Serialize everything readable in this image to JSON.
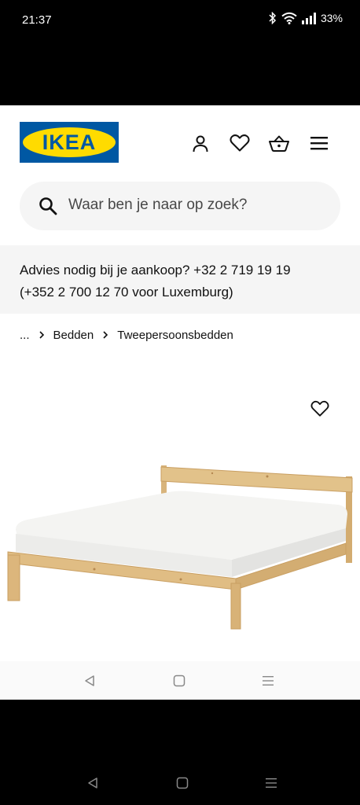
{
  "status_bar": {
    "time": "21:37",
    "battery": "33%",
    "icons": [
      "bluetooth-icon",
      "wifi-icon",
      "signal-icon"
    ]
  },
  "header": {
    "logo_text": "IKEA",
    "brand_colors": {
      "blue": "#0058a3",
      "yellow": "#ffdb00"
    },
    "icons": [
      "account-icon",
      "wishlist-heart-icon",
      "shopping-basket-icon",
      "menu-icon"
    ]
  },
  "search": {
    "placeholder": "Waar ben je naar op zoek?",
    "icon": "search-icon"
  },
  "advice_banner": {
    "line1": "Advies nodig bij je aankoop? +32 2 719 19 19",
    "line2": "(+352 2 700 12 70 voor Luxemburg)"
  },
  "breadcrumb": {
    "items": [
      "...",
      "Bedden",
      "Tweepersoonsbedden"
    ]
  },
  "product": {
    "favorite_icon": "favorite-heart-icon",
    "image_subject": "pine-wood-bed-frame-with-mattress"
  },
  "web_nav": {
    "icons": [
      "back-icon",
      "home-icon",
      "menu-lines-icon"
    ]
  },
  "system_nav": {
    "icons": [
      "back-icon",
      "home-icon",
      "recents-icon"
    ]
  }
}
